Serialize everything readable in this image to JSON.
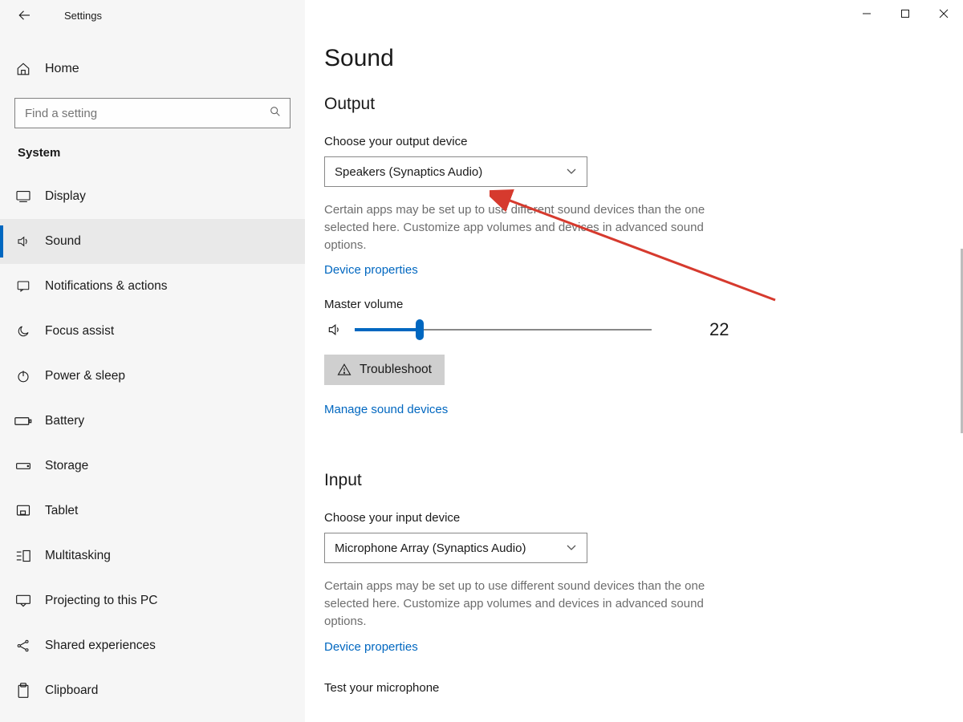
{
  "window": {
    "title": "Settings"
  },
  "sidebar": {
    "home_label": "Home",
    "search_placeholder": "Find a setting",
    "section_title": "System",
    "items": [
      {
        "label": "Display"
      },
      {
        "label": "Sound"
      },
      {
        "label": "Notifications & actions"
      },
      {
        "label": "Focus assist"
      },
      {
        "label": "Power & sleep"
      },
      {
        "label": "Battery"
      },
      {
        "label": "Storage"
      },
      {
        "label": "Tablet"
      },
      {
        "label": "Multitasking"
      },
      {
        "label": "Projecting to this PC"
      },
      {
        "label": "Shared experiences"
      },
      {
        "label": "Clipboard"
      }
    ]
  },
  "main": {
    "page_title": "Sound",
    "output": {
      "heading": "Output",
      "choose_label": "Choose your output device",
      "device_selected": "Speakers (Synaptics Audio)",
      "help_text": "Certain apps may be set up to use different sound devices than the one selected here. Customize app volumes and devices in advanced sound options.",
      "device_properties": "Device properties",
      "master_volume_label": "Master volume",
      "volume_value": "22",
      "troubleshoot_label": "Troubleshoot",
      "manage_devices": "Manage sound devices"
    },
    "input": {
      "heading": "Input",
      "choose_label": "Choose your input device",
      "device_selected": "Microphone Array (Synaptics Audio)",
      "help_text": "Certain apps may be set up to use different sound devices than the one selected here. Customize app volumes and devices in advanced sound options.",
      "device_properties": "Device properties",
      "test_label": "Test your microphone"
    }
  },
  "colors": {
    "accent": "#0067c0"
  }
}
